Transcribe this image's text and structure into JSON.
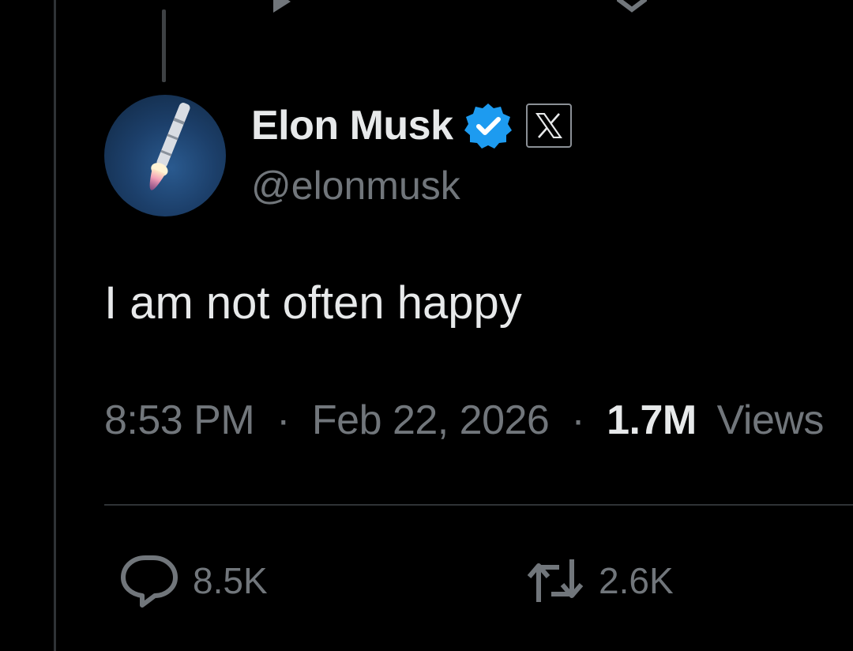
{
  "author": {
    "display_name": "Elon Musk",
    "handle": "@elonmusk",
    "avatar_icon": "rocket-launch-avatar",
    "verified": true,
    "affiliate_badge_icon": "x-logo-icon"
  },
  "tweet": {
    "text": "I am not often happy",
    "time": "8:53 PM",
    "separator": "·",
    "date": "Feb 22, 2026",
    "views_count": "1.7M",
    "views_label": "Views"
  },
  "actions": {
    "reply_count": "8.5K",
    "retweet_count": "2.6K"
  },
  "colors": {
    "background": "#000000",
    "primary_text": "#e7e9ea",
    "secondary_text": "#71767b",
    "verified_blue": "#1d9bf0",
    "divider": "#2f3336"
  }
}
